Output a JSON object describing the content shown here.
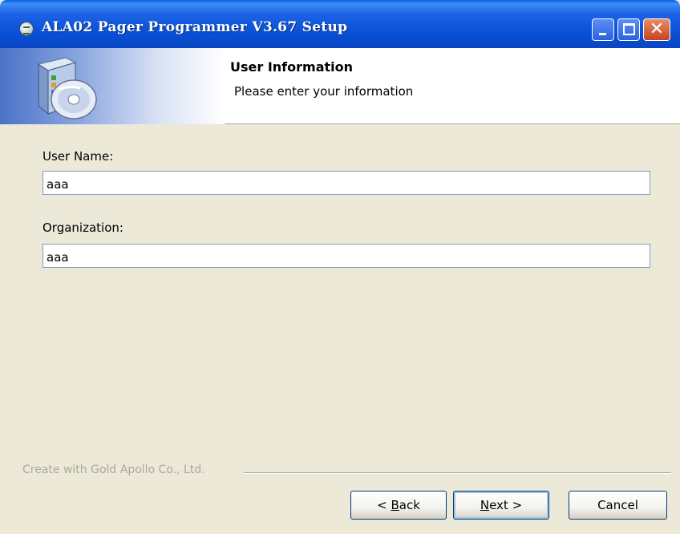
{
  "window": {
    "title": "ALA02 Pager Programmer V3.67 Setup",
    "icon": "setup-app-icon",
    "controls": [
      "minimize",
      "maximize",
      "close"
    ]
  },
  "header": {
    "title": "User Information",
    "subtitle": "Please enter your information",
    "icon": "install-cd-icon"
  },
  "form": {
    "user_name_label": "User Name:",
    "user_name_value": "aaa",
    "organization_label": "Organization:",
    "organization_value": "aaa"
  },
  "footer": {
    "brand": "Create with Gold Apollo Co., Ltd.",
    "back_prefix": "< ",
    "back_mnemonic": "B",
    "back_rest": "ack",
    "next_mnemonic": "N",
    "next_rest": "ext >",
    "cancel_label": "Cancel"
  },
  "colors": {
    "titlebar": "#0A4FD6",
    "dialog_bg": "#ECE9D8",
    "input_border": "#7F9DB9",
    "button_border": "#003C74",
    "close_button": "#C8421C"
  }
}
